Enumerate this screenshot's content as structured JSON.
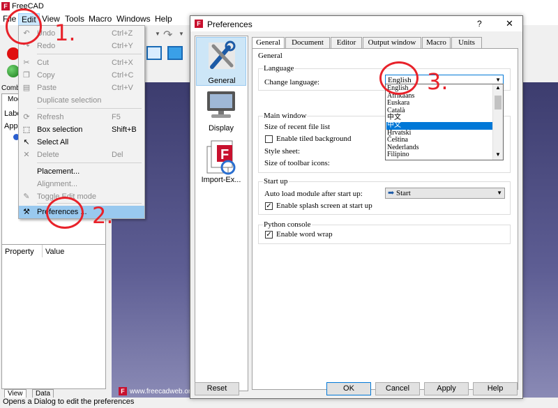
{
  "app": {
    "title": "FreeCAD",
    "status": "Opens a Dialog to edit the preferences"
  },
  "menubar": [
    "File",
    "Edit",
    "View",
    "Tools",
    "Macro",
    "Windows",
    "Help"
  ],
  "left_panel": {
    "combo_tab": "Combo",
    "model_tab": "Mod",
    "labels_header": "Labe",
    "app_label": "Appl",
    "property_header": "Property",
    "value_header": "Value",
    "bottom_tabs": [
      "View",
      "Data"
    ]
  },
  "edit_menu": [
    {
      "label": "Undo",
      "shortcut": "Ctrl+Z",
      "enabled": false,
      "icon": "undo-icon"
    },
    {
      "label": "Redo",
      "shortcut": "Ctrl+Y",
      "enabled": false,
      "icon": "redo-icon"
    },
    {
      "label": "Cut",
      "shortcut": "Ctrl+X",
      "enabled": false,
      "icon": "cut-icon"
    },
    {
      "label": "Copy",
      "shortcut": "Ctrl+C",
      "enabled": false,
      "icon": "copy-icon"
    },
    {
      "label": "Paste",
      "shortcut": "Ctrl+V",
      "enabled": false,
      "icon": "paste-icon"
    },
    {
      "label": "Duplicate selection",
      "shortcut": "",
      "enabled": false,
      "icon": ""
    },
    {
      "label": "Refresh",
      "shortcut": "F5",
      "enabled": false,
      "icon": "refresh-icon"
    },
    {
      "label": "Box selection",
      "shortcut": "Shift+B",
      "enabled": true,
      "icon": "box-selection-icon"
    },
    {
      "label": "Select All",
      "shortcut": "",
      "enabled": true,
      "icon": "select-all-icon"
    },
    {
      "label": "Delete",
      "shortcut": "Del",
      "enabled": false,
      "icon": "delete-icon"
    },
    {
      "label": "Placement...",
      "shortcut": "",
      "enabled": true,
      "icon": ""
    },
    {
      "label": "Alignment...",
      "shortcut": "",
      "enabled": false,
      "icon": ""
    },
    {
      "label": "Toggle Edit mode",
      "shortcut": "",
      "enabled": false,
      "icon": "edit-mode-icon"
    },
    {
      "label": "Preferences ...",
      "shortcut": "",
      "enabled": true,
      "icon": "preferences-icon"
    }
  ],
  "dialog": {
    "title": "Preferences",
    "help_btn": "?",
    "close_btn": "✕",
    "categories": [
      "General",
      "Display",
      "Import-Ex..."
    ],
    "tabs": [
      "General",
      "Document",
      "Editor",
      "Output window",
      "Macro",
      "Units"
    ],
    "group_general": "General",
    "language_group": "Language",
    "change_language_label": "Change language:",
    "language_value": "English",
    "language_options": [
      "English",
      "Afrikaans",
      "Euskara",
      "Català",
      "中文",
      "中文",
      "Hrvatski",
      "Čeština",
      "Nederlands",
      "Filipino"
    ],
    "main_window_group": "Main window",
    "recent_files_label": "Size of recent file list",
    "tiled_bg_label": "Enable tiled background",
    "style_sheet_label": "Style sheet:",
    "toolbar_icons_label": "Size of toolbar icons:",
    "startup_group": "Start up",
    "autoload_label": "Auto load module after start up:",
    "autoload_value": "Start",
    "splash_label": "Enable splash screen at start up",
    "python_group": "Python console",
    "word_wrap_label": "Enable word wrap",
    "buttons": {
      "reset": "Reset",
      "ok": "OK",
      "cancel": "Cancel",
      "apply": "Apply",
      "help": "Help"
    }
  },
  "viewport": {
    "watermark": "www.freecadweb.or"
  },
  "annotations": [
    "1.",
    "2.",
    "3."
  ],
  "colors": {
    "annotation": "#e8222a",
    "highlight": "#99c9ef",
    "selection": "#0078d7"
  }
}
